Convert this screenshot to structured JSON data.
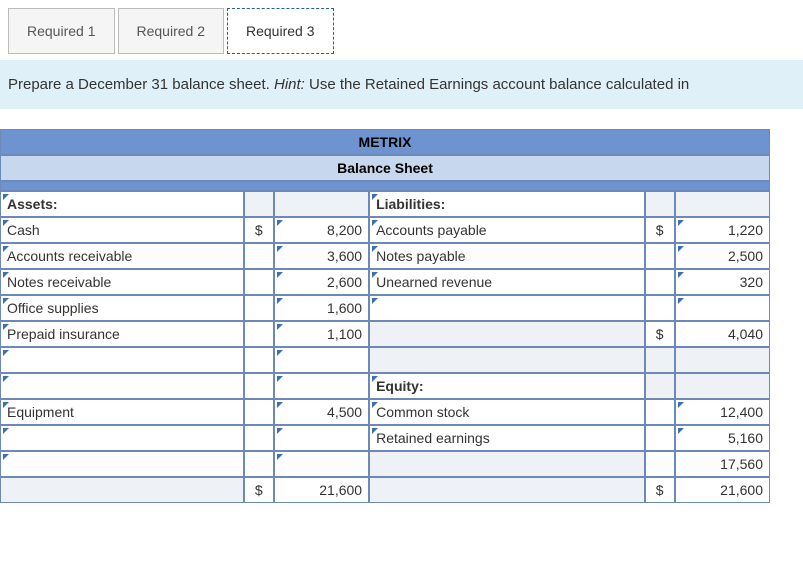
{
  "tabs": [
    "Required 1",
    "Required 2",
    "Required 3"
  ],
  "active_tab_index": 2,
  "instruction": {
    "pre": "Prepare a December 31 balance sheet. ",
    "hint_label": "Hint:",
    "post": " Use the Retained Earnings account balance calculated in"
  },
  "sheet": {
    "company": "METRIX",
    "title": "Balance Sheet",
    "assets_header": "Assets:",
    "liabilities_header": "Liabilities:",
    "equity_header": "Equity:",
    "asset_rows": [
      {
        "label": "Cash",
        "sym": "$",
        "val": "8,200"
      },
      {
        "label": "Accounts receivable",
        "sym": "",
        "val": "3,600"
      },
      {
        "label": "Notes receivable",
        "sym": "",
        "val": "2,600"
      },
      {
        "label": "Office supplies",
        "sym": "",
        "val": "1,600"
      },
      {
        "label": "Prepaid insurance",
        "sym": "",
        "val": "1,100"
      },
      {
        "label": "",
        "sym": "",
        "val": ""
      },
      {
        "label": "",
        "sym": "",
        "val": ""
      },
      {
        "label": "Equipment",
        "sym": "",
        "val": "4,500"
      },
      {
        "label": "",
        "sym": "",
        "val": ""
      },
      {
        "label": "",
        "sym": "",
        "val": ""
      }
    ],
    "assets_total": {
      "sym": "$",
      "val": "21,600"
    },
    "liab_rows": [
      {
        "label": "Accounts payable",
        "sym": "$",
        "val": "1,220"
      },
      {
        "label": "Notes payable",
        "sym": "",
        "val": "2,500"
      },
      {
        "label": "Unearned revenue",
        "sym": "",
        "val": "320"
      },
      {
        "label": "",
        "sym": "",
        "val": ""
      }
    ],
    "liab_total": {
      "sym": "$",
      "val": "4,040"
    },
    "equity_rows": [
      {
        "label": "Common stock",
        "sym": "",
        "val": "12,400"
      },
      {
        "label": "Retained earnings",
        "sym": "",
        "val": "5,160"
      }
    ],
    "equity_subtotal": {
      "sym": "",
      "val": "17,560"
    },
    "grand_total": {
      "sym": "$",
      "val": "21,600"
    }
  }
}
